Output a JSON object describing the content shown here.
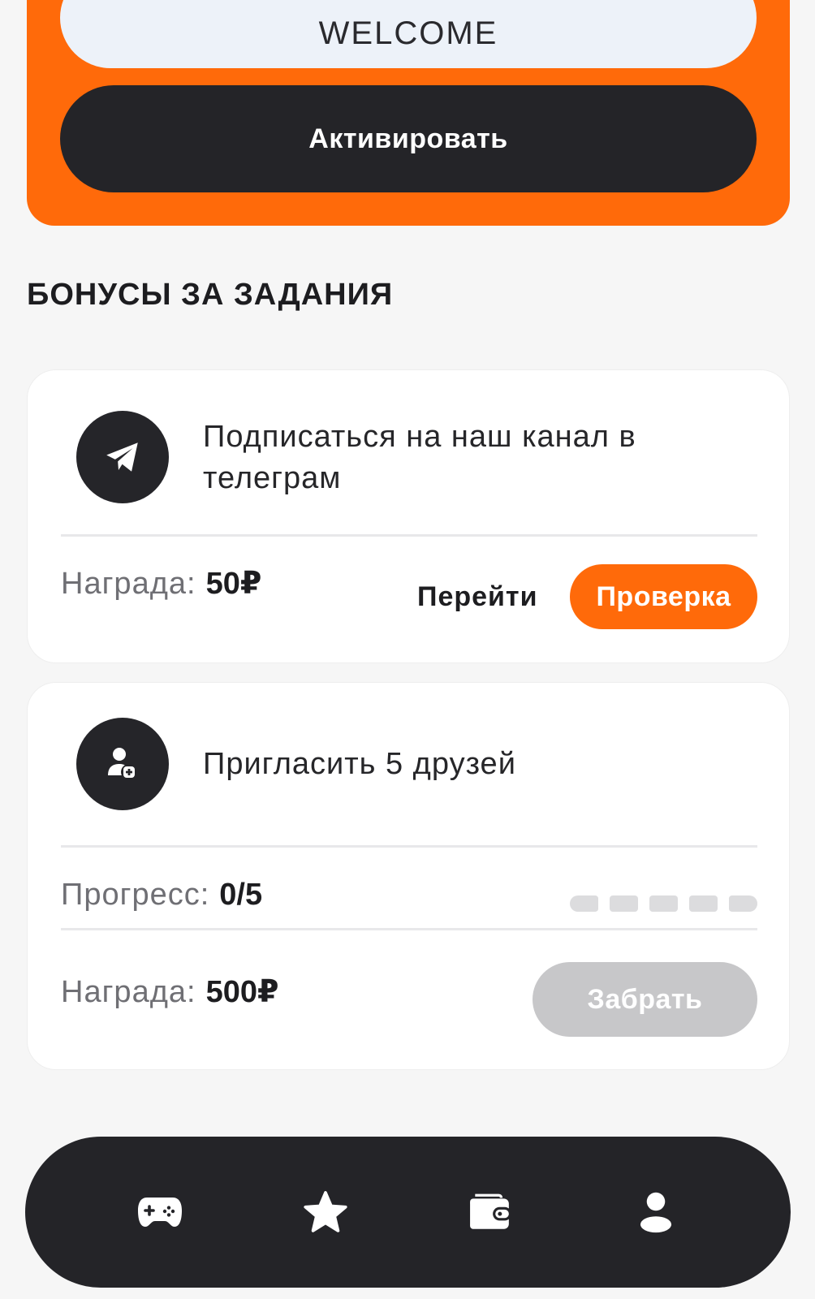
{
  "promo": {
    "code_value": "WELCOME",
    "activate_label": "Активировать",
    "color": "#ff6a0a"
  },
  "section": {
    "title": "БОНУСЫ ЗА ЗАДАНИЯ"
  },
  "tasks": [
    {
      "icon": "telegram-icon",
      "title": "Подписаться на наш канал в телеграм",
      "reward_label": "Награда:",
      "reward_value": "50₽",
      "goto_label": "Перейти",
      "check_label": "Проверка"
    },
    {
      "icon": "add-user-icon",
      "title": "Пригласить 5 друзей",
      "progress_label": "Прогресс:",
      "progress_value": "0/5",
      "progress_current": 0,
      "progress_total": 5,
      "reward_label": "Награда:",
      "reward_value": "500₽",
      "claim_label": "Забрать"
    }
  ],
  "nav": {
    "items": [
      {
        "icon": "gamepad-icon"
      },
      {
        "icon": "star-icon"
      },
      {
        "icon": "wallet-icon"
      },
      {
        "icon": "user-icon"
      }
    ]
  }
}
